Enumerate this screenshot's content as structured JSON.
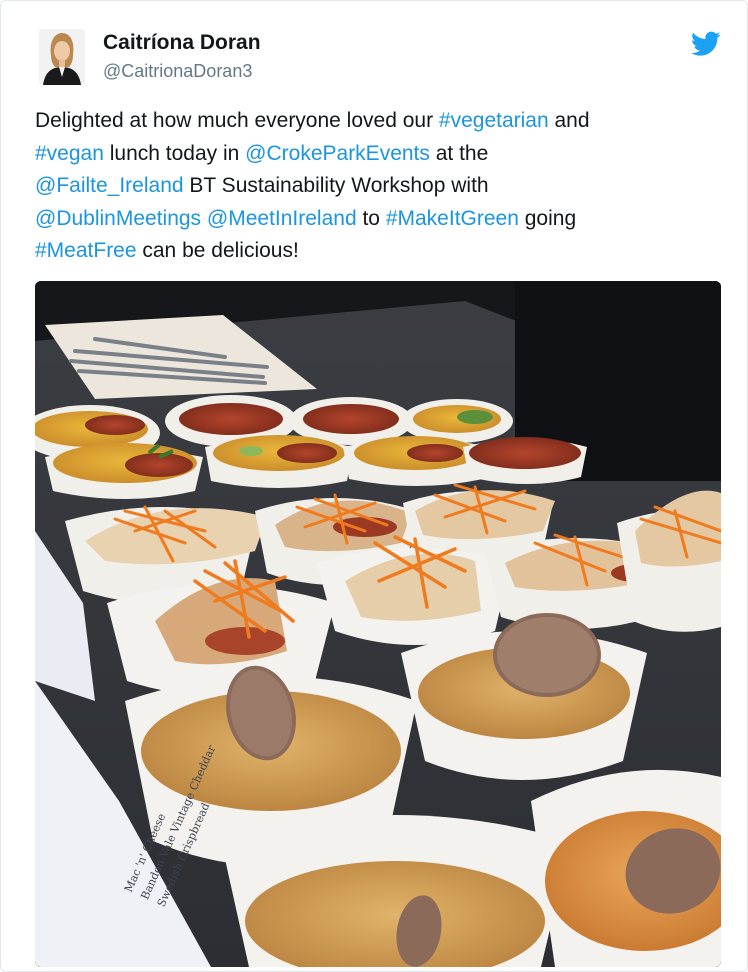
{
  "author": {
    "name": "Caitríona Doran",
    "handle": "@CaitrionaDoran3"
  },
  "tweet": {
    "lines": [
      [
        {
          "t": "Delighted at how much everyone loved our ",
          "link": false
        },
        {
          "t": "#vegetarian",
          "link": true
        },
        {
          "t": " and",
          "link": false
        }
      ],
      [
        {
          "t": "#vegan",
          "link": true
        },
        {
          "t": " lunch today in ",
          "link": false
        },
        {
          "t": "@CrokeParkEvents",
          "link": true
        },
        {
          "t": " at the",
          "link": false
        }
      ],
      [
        {
          "t": "@Failte_Ireland",
          "link": true
        },
        {
          "t": " BT Sustainability Workshop with",
          "link": false
        }
      ],
      [
        {
          "t": "@DublinMeetings",
          "link": true
        },
        {
          "t": " ",
          "link": false
        },
        {
          "t": "@MeetInIreland",
          "link": true
        },
        {
          "t": " to ",
          "link": false
        },
        {
          "t": "#MakeItGreen",
          "link": true
        },
        {
          "t": " going",
          "link": false
        }
      ],
      [
        {
          "t": "#MeatFree",
          "link": true
        },
        {
          "t": " can be delicious!",
          "link": false
        }
      ]
    ]
  },
  "photo": {
    "menu_card_lines": [
      "Mac 'n' Cheese",
      "Bandon Vale Vintage Cheddar",
      "Swedish Crispbread"
    ]
  },
  "colors": {
    "link": "#1b95e0",
    "text": "#14171a",
    "handle": "#657786",
    "twitter_blue": "#1da1f2"
  },
  "icons": {
    "twitter_logo": "twitter-bird-icon"
  }
}
